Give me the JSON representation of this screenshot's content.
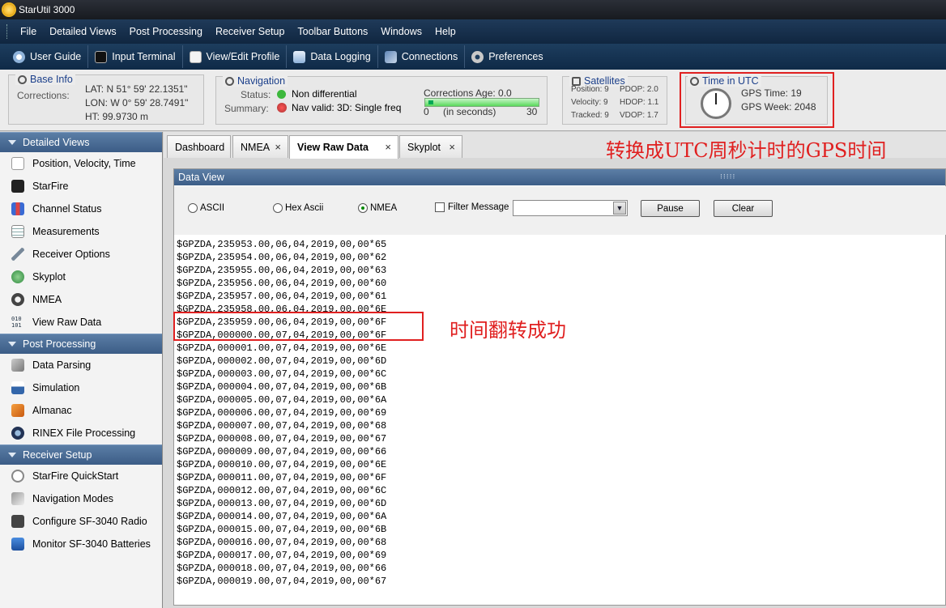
{
  "window": {
    "title": "StarUtil 3000"
  },
  "menu": [
    "File",
    "Detailed Views",
    "Post Processing",
    "Receiver Setup",
    "Toolbar Buttons",
    "Windows",
    "Help"
  ],
  "toolbar": [
    {
      "label": "User Guide",
      "icon": "user-guide-icon"
    },
    {
      "label": "Input Terminal",
      "icon": "terminal-icon"
    },
    {
      "label": "View/Edit Profile",
      "icon": "profile-icon"
    },
    {
      "label": "Data Logging",
      "icon": "data-logging-icon"
    },
    {
      "label": "Connections",
      "icon": "connections-icon"
    },
    {
      "label": "Preferences",
      "icon": "gear-icon"
    }
  ],
  "base_info": {
    "title": "Base Info",
    "corrections_label": "Corrections:",
    "lat": "LAT: N 51° 59' 22.1351\"",
    "lon": "LON: W 0° 59' 28.7491\"",
    "ht": "HT: 99.9730 m"
  },
  "navigation": {
    "title": "Navigation",
    "status_label": "Status:",
    "status_value": "Non differential",
    "summary_label": "Summary:",
    "summary_value": "Nav valid: 3D: Single freq",
    "corrections_age": "Corrections Age: 0.0",
    "age_min": "0",
    "age_unit": "(in seconds)",
    "age_max": "30"
  },
  "satellites": {
    "title": "Satellites",
    "position": "Position: 9",
    "pdop": "PDOP: 2.0",
    "velocity": "Velocity: 9",
    "hdop": "HDOP: 1.1",
    "tracked": "Tracked: 9",
    "vdop": "VDOP: 1.7"
  },
  "time_utc": {
    "title": "Time in UTC",
    "gps_time": "GPS Time: 19",
    "gps_week": "GPS Week: 2048"
  },
  "sidebar": {
    "sections": [
      {
        "title": "Detailed Views",
        "items": [
          {
            "label": "Position, Velocity, Time",
            "icon": "chart-icon"
          },
          {
            "label": "StarFire",
            "icon": "satellite-icon"
          },
          {
            "label": "Channel Status",
            "icon": "bar-chart-icon"
          },
          {
            "label": "Measurements",
            "icon": "table-icon"
          },
          {
            "label": "Receiver Options",
            "icon": "wrench-icon"
          },
          {
            "label": "Skyplot",
            "icon": "globe-icon"
          },
          {
            "label": "NMEA",
            "icon": "nmea-gear-icon"
          },
          {
            "label": "View Raw Data",
            "icon": "binary-icon"
          }
        ]
      },
      {
        "title": "Post Processing",
        "items": [
          {
            "label": "Data Parsing",
            "icon": "cube-icon"
          },
          {
            "label": "Simulation",
            "icon": "simulation-icon"
          },
          {
            "label": "Almanac",
            "icon": "book-icon"
          },
          {
            "label": "RINEX File Processing",
            "icon": "rinex-icon"
          }
        ]
      },
      {
        "title": "Receiver Setup",
        "items": [
          {
            "label": "StarFire QuickStart",
            "icon": "clock-icon"
          },
          {
            "label": "Navigation Modes",
            "icon": "navigation-icon"
          },
          {
            "label": "Configure SF-3040 Radio",
            "icon": "radio-icon"
          },
          {
            "label": "Monitor SF-3040 Batteries",
            "icon": "battery-icon"
          }
        ]
      }
    ]
  },
  "tabs": [
    {
      "label": "Dashboard",
      "closable": false
    },
    {
      "label": "NMEA",
      "closable": true
    },
    {
      "label": "View Raw Data",
      "closable": true,
      "active": true
    },
    {
      "label": "Skyplot",
      "closable": true
    }
  ],
  "close_glyph": "×",
  "annotations": {
    "top": "转换成UTC周秒计时的GPS时间",
    "rollover": "时间翻转成功"
  },
  "data_view": {
    "title": "Data View",
    "grip": "⁝⁝⁝⁝⁝",
    "radios": [
      {
        "label": "ASCII",
        "selected": false
      },
      {
        "label": "Hex Ascii",
        "selected": false
      },
      {
        "label": "NMEA",
        "selected": true
      }
    ],
    "filter_label": "Filter Message",
    "pause_label": "Pause",
    "clear_label": "Clear",
    "lines": [
      "$GPZDA,235953.00,06,04,2019,00,00*65",
      "$GPZDA,235954.00,06,04,2019,00,00*62",
      "$GPZDA,235955.00,06,04,2019,00,00*63",
      "$GPZDA,235956.00,06,04,2019,00,00*60",
      "$GPZDA,235957.00,06,04,2019,00,00*61",
      "$GPZDA,235958.00,06,04,2019,00,00*6E",
      "$GPZDA,235959.00,06,04,2019,00,00*6F",
      "$GPZDA,000000.00,07,04,2019,00,00*6F",
      "$GPZDA,000001.00,07,04,2019,00,00*6E",
      "$GPZDA,000002.00,07,04,2019,00,00*6D",
      "$GPZDA,000003.00,07,04,2019,00,00*6C",
      "$GPZDA,000004.00,07,04,2019,00,00*6B",
      "$GPZDA,000005.00,07,04,2019,00,00*6A",
      "$GPZDA,000006.00,07,04,2019,00,00*69",
      "$GPZDA,000007.00,07,04,2019,00,00*68",
      "$GPZDA,000008.00,07,04,2019,00,00*67",
      "$GPZDA,000009.00,07,04,2019,00,00*66",
      "$GPZDA,000010.00,07,04,2019,00,00*6E",
      "$GPZDA,000011.00,07,04,2019,00,00*6F",
      "$GPZDA,000012.00,07,04,2019,00,00*6C",
      "$GPZDA,000013.00,07,04,2019,00,00*6D",
      "$GPZDA,000014.00,07,04,2019,00,00*6A",
      "$GPZDA,000015.00,07,04,2019,00,00*6B",
      "$GPZDA,000016.00,07,04,2019,00,00*68",
      "$GPZDA,000017.00,07,04,2019,00,00*69",
      "$GPZDA,000018.00,07,04,2019,00,00*66",
      "$GPZDA,000019.00,07,04,2019,00,00*67"
    ]
  },
  "colors": {
    "accent": "#1b3f8a",
    "annotation": "#e02020",
    "header": "#3b5c86"
  }
}
